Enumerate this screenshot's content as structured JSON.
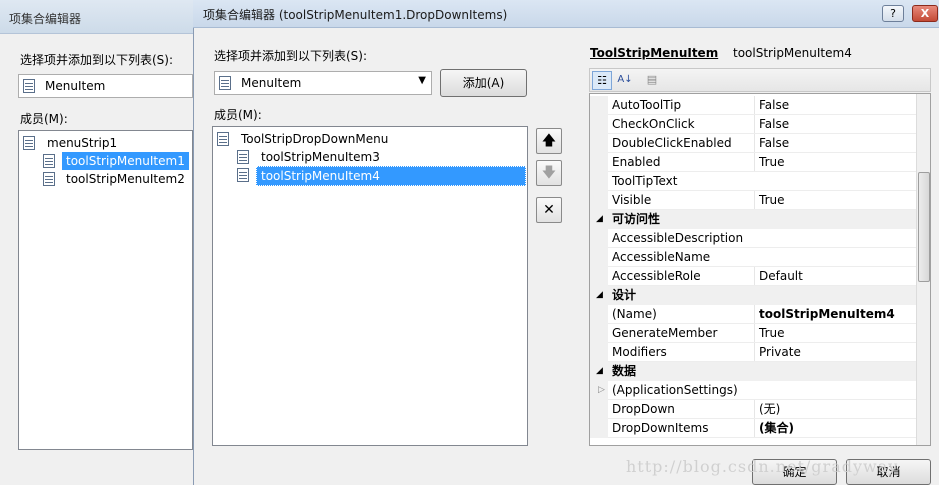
{
  "back_window": {
    "title": "项集合编辑器",
    "select_label": "选择项并添加到以下列表(S):",
    "combo_value": "MenuItem",
    "members_label": "成员(M):",
    "tree": [
      {
        "label": "menuStrip1"
      },
      {
        "label": "toolStripMenuItem1"
      },
      {
        "label": "toolStripMenuItem2"
      }
    ]
  },
  "dialog": {
    "title": "项集合编辑器 (toolStripMenuItem1.DropDownItems)",
    "help_button": "?",
    "close_button": "X",
    "select_label": "选择项并添加到以下列表(S):",
    "combo_value": "MenuItem",
    "add_button": "添加(A)",
    "members_label": "成员(M):",
    "members": [
      {
        "label": "ToolStripDropDownMenu"
      },
      {
        "label": "toolStripMenuItem3"
      },
      {
        "label": "toolStripMenuItem4"
      }
    ],
    "move_up": "🡅",
    "move_down": "🡇",
    "remove": "✕",
    "ok_button": "确定",
    "cancel_button": "取消"
  },
  "property_header": {
    "type_name": "ToolStripMenuItem",
    "object_name": "toolStripMenuItem4"
  },
  "properties": [
    {
      "name": "AutoToolTip",
      "value": "False"
    },
    {
      "name": "CheckOnClick",
      "value": "False"
    },
    {
      "name": "DoubleClickEnabled",
      "value": "False"
    },
    {
      "name": "Enabled",
      "value": "True"
    },
    {
      "name": "ToolTipText",
      "value": ""
    },
    {
      "name": "Visible",
      "value": "True"
    },
    {
      "name": "可访问性",
      "value": ""
    },
    {
      "name": "AccessibleDescription",
      "value": ""
    },
    {
      "name": "AccessibleName",
      "value": ""
    },
    {
      "name": "AccessibleRole",
      "value": "Default"
    },
    {
      "name": "设计",
      "value": ""
    },
    {
      "name": "(Name)",
      "value": "toolStripMenuItem4"
    },
    {
      "name": "GenerateMember",
      "value": "True"
    },
    {
      "name": "Modifiers",
      "value": "Private"
    },
    {
      "name": "数据",
      "value": ""
    },
    {
      "name": "(ApplicationSettings)",
      "value": ""
    },
    {
      "name": "DropDown",
      "value": "(无)"
    },
    {
      "name": "DropDownItems",
      "value": "(集合)"
    }
  ],
  "watermark": "http://blog.csdn.net/gradyway"
}
